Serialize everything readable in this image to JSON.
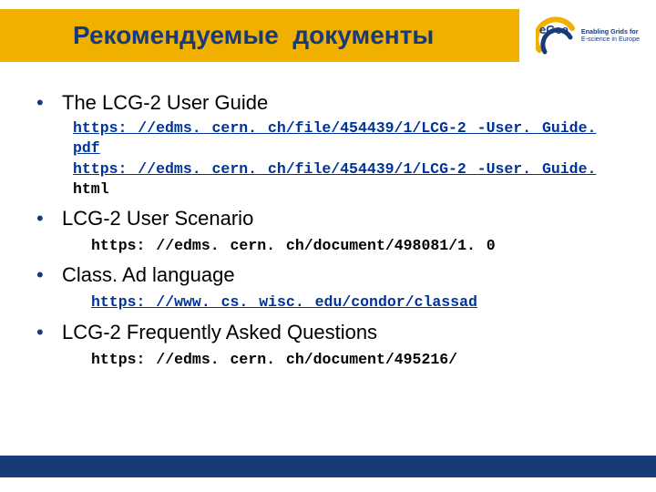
{
  "header": {
    "title": "Рекомендуемые  документы",
    "logo": {
      "line1": "Enabling Grids for",
      "line2": "E-science in Europe"
    }
  },
  "items": [
    {
      "title": "The LCG-2 User Guide",
      "links": [
        "https: //edms. cern. ch/file/454439/1/LCG-2 -User. Guide. pdf",
        {
          "linked": "https: //edms. cern. ch/file/454439/1/LCG-2 -User. Guide. ",
          "suffix": "html"
        }
      ]
    },
    {
      "title": "LCG-2 User Scenario",
      "text": "https: //edms. cern. ch/document/498081/1. 0"
    },
    {
      "title": "Class. Ad language",
      "link": "https: //www. cs. wisc. edu/condor/classad"
    },
    {
      "title": "LCG-2 Frequently Asked Questions",
      "text": "https: //edms. cern. ch/document/495216/"
    }
  ]
}
